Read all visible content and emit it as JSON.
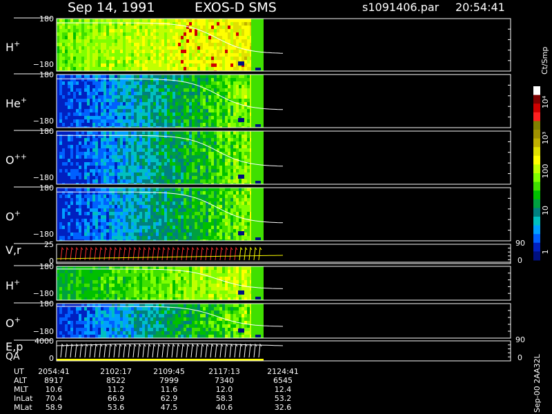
{
  "header": {
    "date": "Sep 14, 1991",
    "instrument": "EXOS-D SMS",
    "file": "s1091406.par",
    "time": "20:54:41"
  },
  "colorbar": {
    "unit": "Ct/Smp",
    "labels": [
      "10⁴",
      "10³",
      "100",
      "10",
      "1"
    ],
    "colors": [
      "#ffffff",
      "#800000",
      "#d00000",
      "#ff2020",
      "#808000",
      "#a09000",
      "#c0b000",
      "#e0e000",
      "#ffff00",
      "#c0ff00",
      "#80ff00",
      "#40e000",
      "#00c000",
      "#00a040",
      "#008080",
      "#00c0c0",
      "#00a0ff",
      "#0060ff",
      "#0020c0",
      "#001080"
    ]
  },
  "chart_data": [
    {
      "type": "heatmap",
      "label_main": "H",
      "label_sup": "+",
      "ylim": [
        -180,
        180
      ],
      "ticks": [
        "180",
        "−180"
      ],
      "palette": "warm"
    },
    {
      "type": "heatmap",
      "label_main": "He",
      "label_sup": "+",
      "ylim": [
        -180,
        180
      ],
      "ticks": [
        "180",
        "−180"
      ],
      "palette": "cool"
    },
    {
      "type": "heatmap",
      "label_main": "O",
      "label_sup": "++",
      "ylim": [
        -180,
        180
      ],
      "ticks": [
        "180",
        "−180"
      ],
      "palette": "cool"
    },
    {
      "type": "heatmap",
      "label_main": "O",
      "label_sup": "+",
      "ylim": [
        -180,
        180
      ],
      "ticks": [
        "180",
        "−180"
      ],
      "palette": "cool"
    },
    {
      "type": "line",
      "label_main": "V,r",
      "label_sup": "",
      "ticks": [
        "25",
        "0"
      ],
      "right_ticks": [
        "90",
        "0"
      ]
    },
    {
      "type": "heatmap",
      "label_main": "H",
      "label_sup": "+",
      "ylim": [
        -180,
        180
      ],
      "ticks": [
        "180",
        "−180"
      ],
      "palette": "mid"
    },
    {
      "type": "heatmap",
      "label_main": "O",
      "label_sup": "+",
      "ylim": [
        -180,
        180
      ],
      "ticks": [
        "180",
        "−180"
      ],
      "palette": "cool"
    },
    {
      "type": "line",
      "label_main": "E,p",
      "label_sup": "",
      "label2": "QA",
      "ticks": [
        "4000",
        "0"
      ],
      "right_ticks": [
        "90",
        "0"
      ]
    }
  ],
  "orbit": {
    "rows": [
      {
        "name": "UT",
        "values": [
          "2054:41",
          "2102:17",
          "2109:45",
          "2117:13",
          "2124:41"
        ]
      },
      {
        "name": "ALT",
        "values": [
          "8917",
          "8522",
          "7999",
          "7340",
          "6545"
        ]
      },
      {
        "name": "MLT",
        "values": [
          "10.6",
          "11.2",
          "11.6",
          "12.0",
          "12.4"
        ]
      },
      {
        "name": "InLat",
        "values": [
          "70.4",
          "66.9",
          "62.9",
          "58.3",
          "53.2"
        ]
      },
      {
        "name": "MLat",
        "values": [
          "58.9",
          "53.6",
          "47.5",
          "40.6",
          "32.6"
        ]
      }
    ]
  },
  "footer": {
    "stamp": "Sep-00 2AA32L"
  }
}
